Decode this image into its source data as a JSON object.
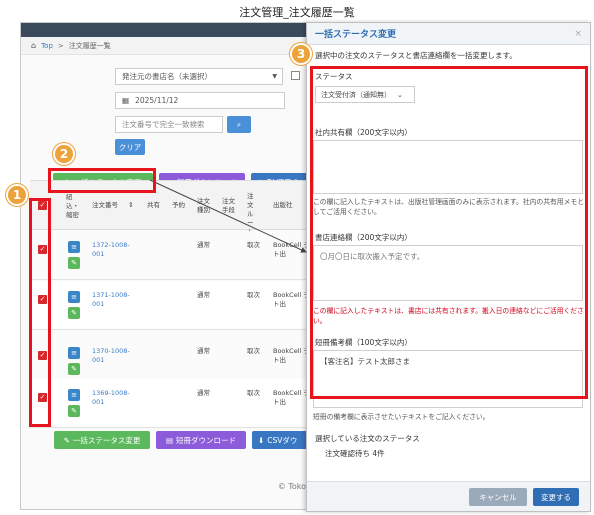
{
  "caption": "注文管理_注文履歴一覧",
  "breadcrumb": {
    "home": "Top",
    "sep": ">",
    "current": "注文履歴一覧"
  },
  "filters": {
    "store_select": "発注元の書店名（未選択）",
    "date_value": "2025/11/12",
    "order_no_placeholder": "注文番号で完全一致検索",
    "search_icon": "search-icon",
    "clear_label": "クリア"
  },
  "toolbar": {
    "bulk_status": "一括ステータス変更",
    "short_download": "短冊ダウンロード",
    "dl_item": "DL項目の"
  },
  "table": {
    "headers": {
      "tie": "紐込・縮密",
      "order_no": "注文番号",
      "common": "共有",
      "reserve": "予約",
      "order_type": "注文種別",
      "order_method": "注文手段",
      "order_route": "注文ルート",
      "publisher": "出版社"
    },
    "rows": [
      {
        "order_no": "1372-1008-001",
        "order_type": "通常",
        "route": "取次",
        "publisher": "BookCell テスト出"
      },
      {
        "order_no": "1371-1008-001",
        "order_type": "通常",
        "route": "取次",
        "publisher": "BookCell テスト出"
      },
      {
        "order_no": "1370-1008-001",
        "order_type": "通常",
        "route": "取次",
        "publisher": "BookCell テスト出"
      },
      {
        "order_no": "1369-1008-001",
        "order_type": "通常",
        "route": "取次",
        "publisher": "BookCell テスト出"
      }
    ]
  },
  "bottom_toolbar": {
    "bulk_status": "一括ステータス変更",
    "short_download": "短冊ダウンロード",
    "csv": "CSVダウ"
  },
  "footer": "© Toko-a",
  "badges": [
    "1",
    "2",
    "3"
  ],
  "modal": {
    "title": "一括ステータス変更",
    "close": "×",
    "intro": "選択中の注文のステータスと書店連絡欄を一括変更します。",
    "status_label": "ステータス",
    "status_value": "注文受付済（通知無）",
    "shared_label": "社内共有欄（200文字以内）",
    "shared_note": "この欄に記入したテキストは、出版社管理画面のみに表示されます。社内の共有用メモとしてご活用ください。",
    "store_label": "書店連絡欄（200文字以内）",
    "store_placeholder": "〇月〇日に取次搬入予定です。",
    "store_note": "この欄に記入したテキストは、書店には共有されます。搬入日の連絡などにご活用ください。",
    "memo_label": "短冊備考欄（100文字以内）",
    "memo_value": "【客注名】テスト太郎さま",
    "memo_note": "短冊の備考欄に表示させたいテキストをご記入ください。",
    "selected_label": "選択している注文のステータス",
    "selected_value": "注文確認待ち 4件",
    "cancel": "キャンセル",
    "submit": "変更する"
  },
  "colors": {
    "accent_red": "#e8141c",
    "badge_orange": "#eea23a",
    "primary_blue": "#3a77c2"
  }
}
